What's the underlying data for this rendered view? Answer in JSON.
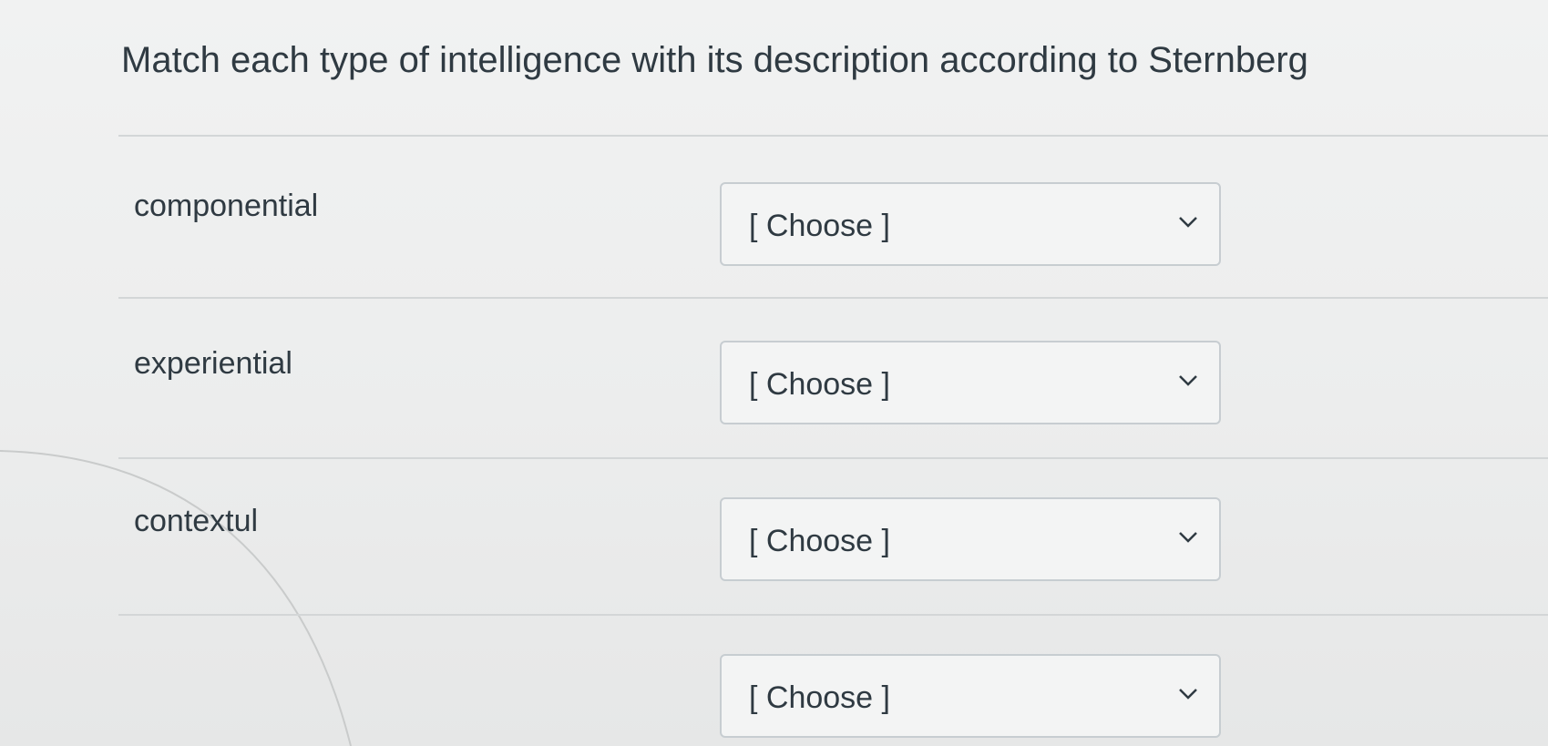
{
  "question": {
    "text": "Match each type of intelligence with its description according to Sternberg"
  },
  "rows": [
    {
      "label": "componential",
      "selected": "[ Choose ]"
    },
    {
      "label": "experiential",
      "selected": "[ Choose ]"
    },
    {
      "label": "contextul",
      "selected": "[ Choose ]"
    },
    {
      "label": "",
      "selected": "[ Choose ]"
    }
  ],
  "icons": {
    "dropdown": "chevron-down-icon"
  }
}
